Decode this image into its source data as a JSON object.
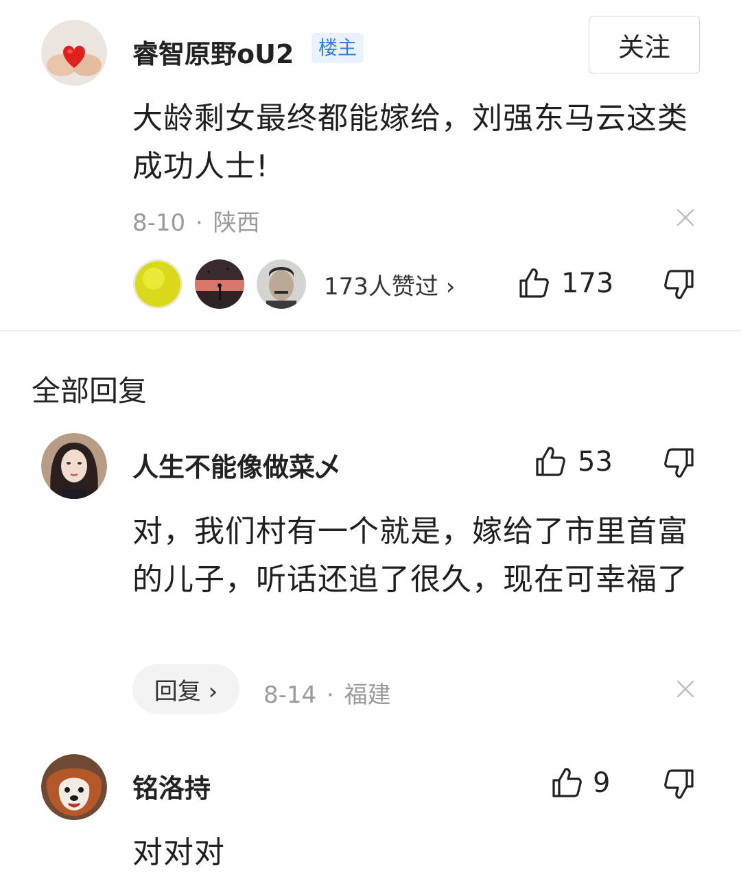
{
  "post": {
    "username": "睿智原野oU2",
    "badge": "楼主",
    "follow_label": "关注",
    "content": "大龄剩女最终都能嫁给，刘强东马云这类成功人士!",
    "date": "8-10",
    "separator": "·",
    "location": "陕西",
    "likers_text": "173人赞过 ›",
    "like_count": "173"
  },
  "section_title": "全部回复",
  "replies": [
    {
      "username": "人生不能像做菜乄",
      "like_count": "53",
      "content": "对，我们村有一个就是，嫁给了市里首富的儿子，听话还追了很久，现在可幸福了",
      "reply_label": "回复 ›",
      "date": "8-14",
      "separator": "·",
      "location": "福建"
    },
    {
      "username": "铭洛持",
      "like_count": "9",
      "content": "对对对"
    }
  ],
  "colors": {
    "badge_bg": "#e8f1fc",
    "badge_text": "#3a7bd5",
    "meta_text": "#9a9a9a"
  },
  "icons": [
    "thumbs-up-icon",
    "thumbs-down-icon",
    "close-icon"
  ]
}
